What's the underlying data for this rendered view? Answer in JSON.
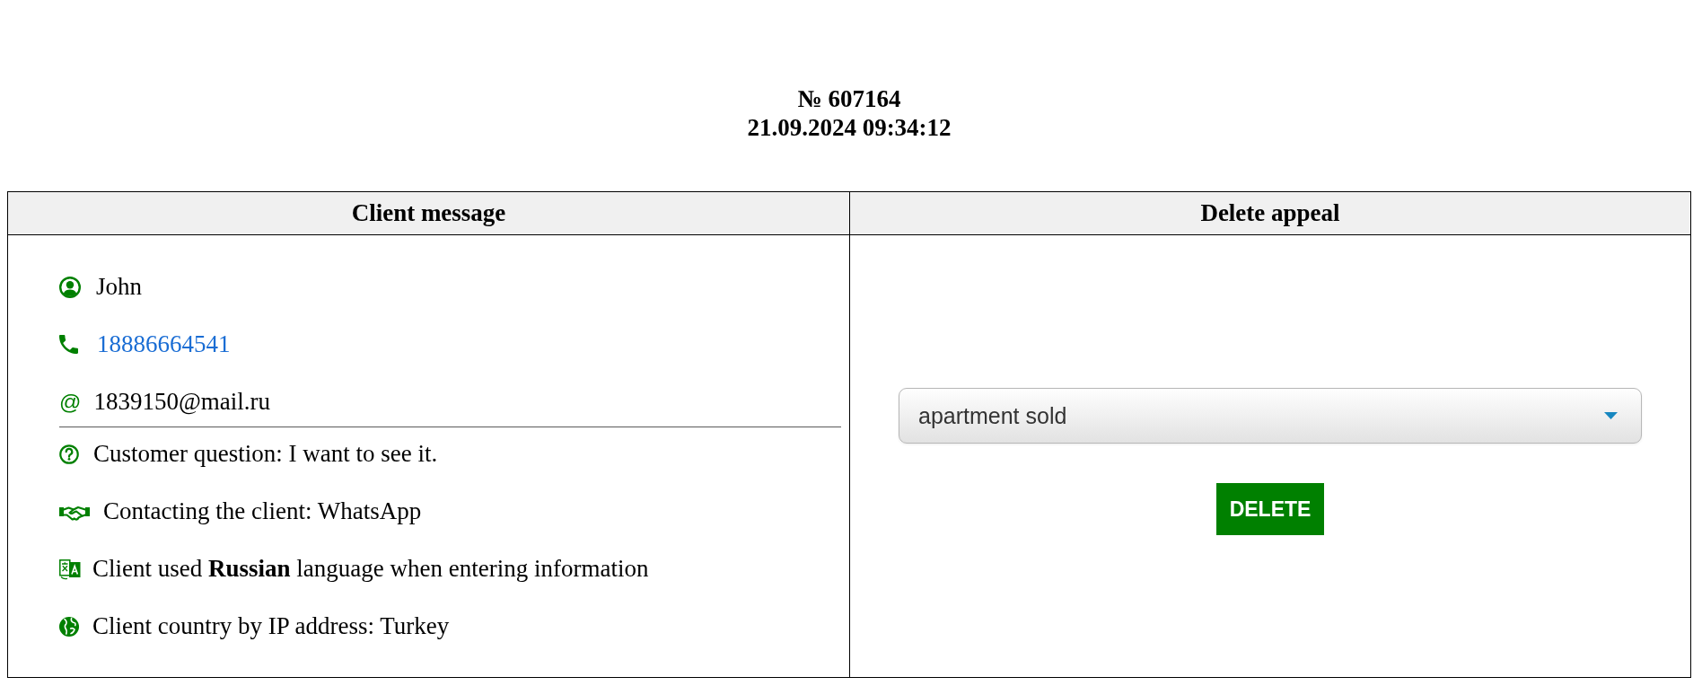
{
  "header": {
    "number": "№ 607164",
    "datetime": "21.09.2024 09:34:12"
  },
  "table": {
    "columns": [
      "Client message",
      "Delete appeal"
    ],
    "client": {
      "contacts": [
        {
          "kind": "name",
          "text": "John"
        },
        {
          "kind": "phone",
          "text": "18886664541"
        },
        {
          "kind": "email",
          "symbol": "@",
          "text": "1839150@mail.ru"
        }
      ],
      "details": [
        {
          "kind": "question",
          "text": "Customer question: I want to see it."
        },
        {
          "kind": "contact_method",
          "text": "Contacting the client: WhatsApp"
        },
        {
          "kind": "language",
          "text": "Client used **Russian** language when entering information"
        },
        {
          "kind": "country",
          "text": "Client country by IP address: Turkey"
        }
      ]
    },
    "delete_form": {
      "reason_select": {
        "value": "apartment sold"
      },
      "delete_button": "DELETE"
    }
  }
}
